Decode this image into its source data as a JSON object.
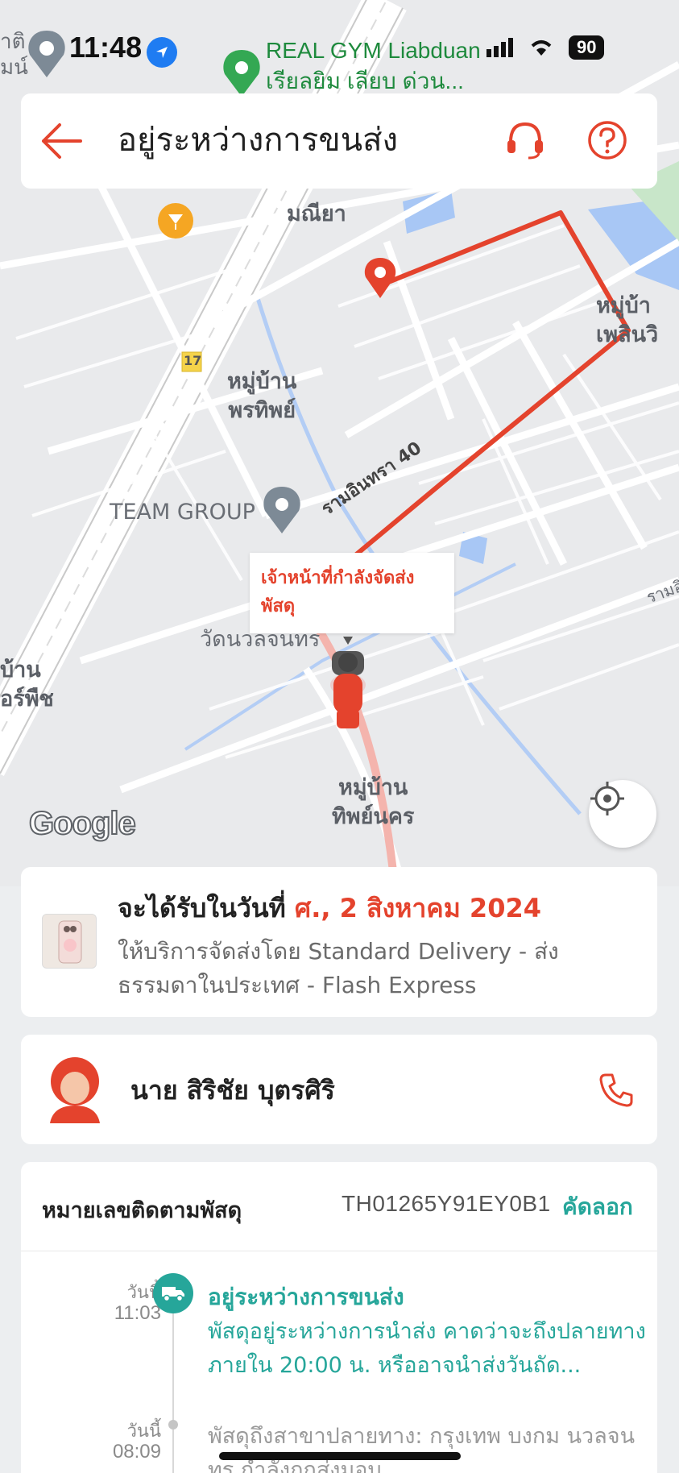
{
  "status_bar": {
    "time": "11:48",
    "battery": "90"
  },
  "map": {
    "poi_gym_line1": "REAL GYM Liabduan",
    "poi_gym_line2": "เรียลยิม เลียบ ด่วน...",
    "labels": {
      "maniya": "มณียา",
      "pornthip": "หมู่บ้าน\nพรทิพย์",
      "phoenvil": "หมู่บ้า\nเพลินวิ",
      "team_group": "TEAM GROUP",
      "road_ramintra": "รามอินทรา 40",
      "wat": "วัดนวลจนทร",
      "thipnakorn": "หมู่บ้าน\nทิพย์นคร",
      "left_edge": "บ้าน\nอร์พืช",
      "highway": "17",
      "corner_top_left": "าติ\nมน์",
      "edge_right": "รามอิ"
    },
    "courier_bubble": "เจ้าหน้าที่กำลังจัดส่ง\nพัสดุ",
    "google_logo": "Google"
  },
  "header": {
    "title": "อยู่ระหว่างการขนส่ง"
  },
  "delivery": {
    "eta_prefix": "จะได้รับในวันที่ ",
    "eta_date": "ศ., 2 สิงหาคม 2024",
    "service": "ให้บริการจัดส่งโดย Standard Delivery - ส่งธรรมดาในประเทศ - Flash Express"
  },
  "courier": {
    "name": "นาย สิริชัย บุตรศิริ"
  },
  "tracking": {
    "label": "หมายเลขติดตามพัสดุ",
    "number": "TH01265Y91EY0B1",
    "copy_label": "คัดลอก",
    "events": [
      {
        "day": "วันนี้",
        "time": "11:03",
        "status": "อยู่ระหว่างการขนส่ง",
        "description": "พัสดุอยู่ระหว่างการนำส่ง คาดว่าจะถึงปลายทางภายใน 20:00 น. หรืออาจนำส่งวันถัด..."
      },
      {
        "day": "วันนี้",
        "time": "08:09",
        "description": "พัสดุถึงสาขาปลายทาง: กรุงเทพ บงกม นวลจนทร กำลังถูกส่งมอบ"
      }
    ]
  },
  "colors": {
    "accent": "#e4432d",
    "teal": "#26a69a"
  }
}
